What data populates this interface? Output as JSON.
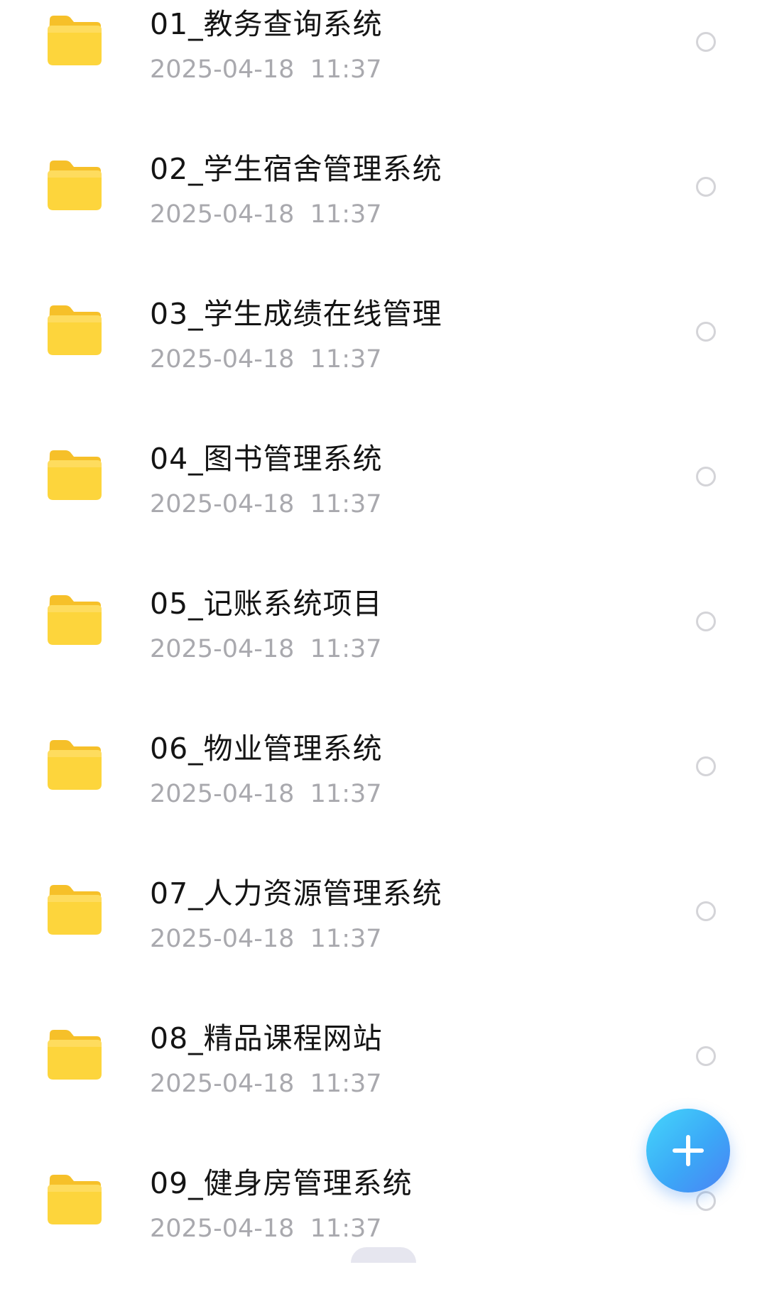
{
  "files": [
    {
      "name": "01_教务查询系统",
      "date": "2025-04-18  11:37",
      "icon": "folder-icon"
    },
    {
      "name": "02_学生宿舍管理系统",
      "date": "2025-04-18  11:37",
      "icon": "folder-icon"
    },
    {
      "name": "03_学生成绩在线管理",
      "date": "2025-04-18  11:37",
      "icon": "folder-icon"
    },
    {
      "name": "04_图书管理系统",
      "date": "2025-04-18  11:37",
      "icon": "folder-icon"
    },
    {
      "name": "05_记账系统项目",
      "date": "2025-04-18  11:37",
      "icon": "folder-icon"
    },
    {
      "name": "06_物业管理系统",
      "date": "2025-04-18  11:37",
      "icon": "folder-icon"
    },
    {
      "name": "07_人力资源管理系统",
      "date": "2025-04-18  11:37",
      "icon": "folder-icon"
    },
    {
      "name": "08_精品课程网站",
      "date": "2025-04-18  11:37",
      "icon": "folder-icon"
    },
    {
      "name": "09_健身房管理系统",
      "date": "2025-04-18  11:37",
      "icon": "folder-icon"
    }
  ],
  "fab": {
    "icon": "plus-icon"
  },
  "colors": {
    "folder": "#fdd13a",
    "folder_tab": "#f8c22c",
    "title_text": "#141414",
    "date_text": "#a9a9ae",
    "radio_border": "#d4d4d8",
    "fab_start": "#45d6fb",
    "fab_end": "#4b82f4"
  }
}
